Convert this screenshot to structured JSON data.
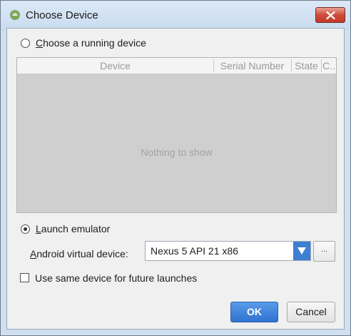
{
  "window": {
    "title": "Choose Device",
    "app_icon": "android-icon",
    "close_icon": "close-icon"
  },
  "running": {
    "label_mnemonic": "C",
    "label_rest": "hoose a running device",
    "selected": false
  },
  "table": {
    "columns": [
      "Device",
      "Serial Number",
      "State",
      "C..."
    ],
    "empty_text": "Nothing to show"
  },
  "emulator": {
    "label_mnemonic": "L",
    "label_rest": "aunch emulator",
    "selected": true,
    "avd_label_mnemonic": "A",
    "avd_label_rest": "ndroid virtual device:",
    "avd_value": "Nexus 5 API 21 x86",
    "browse_label": "..."
  },
  "future": {
    "label": "Use same device for future launches",
    "checked": false
  },
  "buttons": {
    "ok": "OK",
    "cancel": "Cancel"
  },
  "colors": {
    "accent": "#3e7fd1",
    "close": "#cf4b39"
  }
}
